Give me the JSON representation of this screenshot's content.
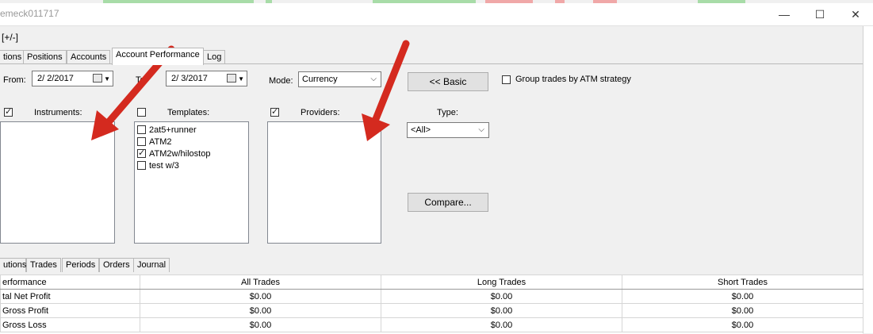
{
  "window": {
    "title": "emeck011717",
    "minimize_glyph": "—",
    "maximize_glyph": "☐",
    "close_glyph": "✕"
  },
  "menu": {
    "toggle_label": "[+/-]"
  },
  "top_tabs": [
    "tions",
    "Positions",
    "Accounts",
    "Account Performance",
    "Log"
  ],
  "filters": {
    "from_label": "From:",
    "from_value": "2/ 2/2017",
    "to_label": "To:",
    "to_value": "2/ 3/2017",
    "mode_label": "Mode:",
    "mode_value": "Currency",
    "basic_button": "<< Basic",
    "group_trades_label": "Group trades by ATM strategy",
    "group_trades_checked": false
  },
  "instruments": {
    "label": "Instruments:",
    "checked": true,
    "items": []
  },
  "templates": {
    "label": "Templates:",
    "checked": false,
    "items": [
      {
        "label": "2at5+runner",
        "checked": false
      },
      {
        "label": "ATM2",
        "checked": false
      },
      {
        "label": "ATM2w/hilostop",
        "checked": true
      },
      {
        "label": "test w/3",
        "checked": false
      }
    ]
  },
  "providers": {
    "label": "Providers:",
    "checked": true,
    "items": []
  },
  "type": {
    "label": "Type:",
    "value": "<All>"
  },
  "compare_button": "Compare...",
  "bottom_tabs": [
    "utions",
    "Trades",
    "Periods",
    "Orders",
    "Journal"
  ],
  "performance": {
    "headers": [
      "erformance",
      "All Trades",
      "Long Trades",
      "Short Trades"
    ],
    "rows": [
      {
        "label": "tal Net Profit",
        "all": "$0.00",
        "long": "$0.00",
        "short": "$0.00"
      },
      {
        "label": "Gross Profit",
        "all": "$0.00",
        "long": "$0.00",
        "short": "$0.00"
      },
      {
        "label": "Gross Loss",
        "all": "$0.00",
        "long": "$0.00",
        "short": "$0.00"
      }
    ]
  },
  "colors": {
    "arrow": "#e8201a",
    "strip_green": "#8fd08f",
    "strip_red": "#f0a0a0"
  }
}
